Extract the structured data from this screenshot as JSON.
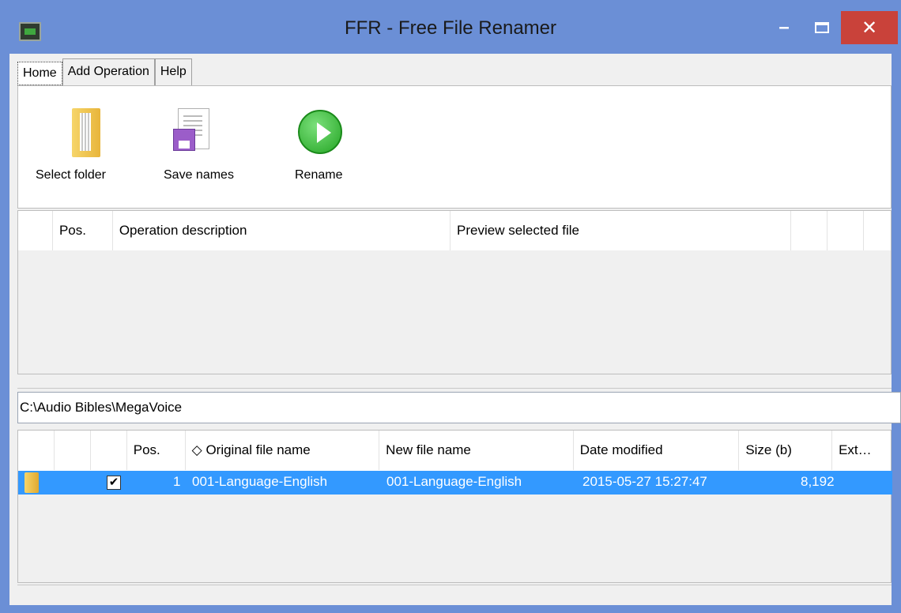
{
  "window": {
    "title": "FFR - Free File Renamer",
    "min_glyph": "–",
    "close_glyph": "✕"
  },
  "tabs": [
    "Home",
    "Add Operation",
    "Help"
  ],
  "ribbon": {
    "select_folder": "Select folder",
    "save_names": "Save names",
    "rename": "Rename"
  },
  "operations": {
    "columns": [
      "",
      "Pos.",
      "Operation description",
      "Preview selected file",
      "",
      "",
      ""
    ]
  },
  "path": "C:\\Audio Bibles\\MegaVoice",
  "files": {
    "columns": [
      "",
      "",
      "",
      "Pos.",
      "◇ Original file name",
      "New file name",
      "Date modified",
      "Size (b)",
      "Ext…"
    ],
    "rows": [
      {
        "checked": "✔",
        "pos": "1",
        "original": "001-Language-English",
        "new": "001-Language-English",
        "date": "2015-05-27 15:27:47",
        "size": "8,192",
        "ext": ""
      }
    ]
  },
  "colors": {
    "titlebar": "#6b8fd6",
    "close": "#c9423a",
    "selection": "#3399ff"
  }
}
